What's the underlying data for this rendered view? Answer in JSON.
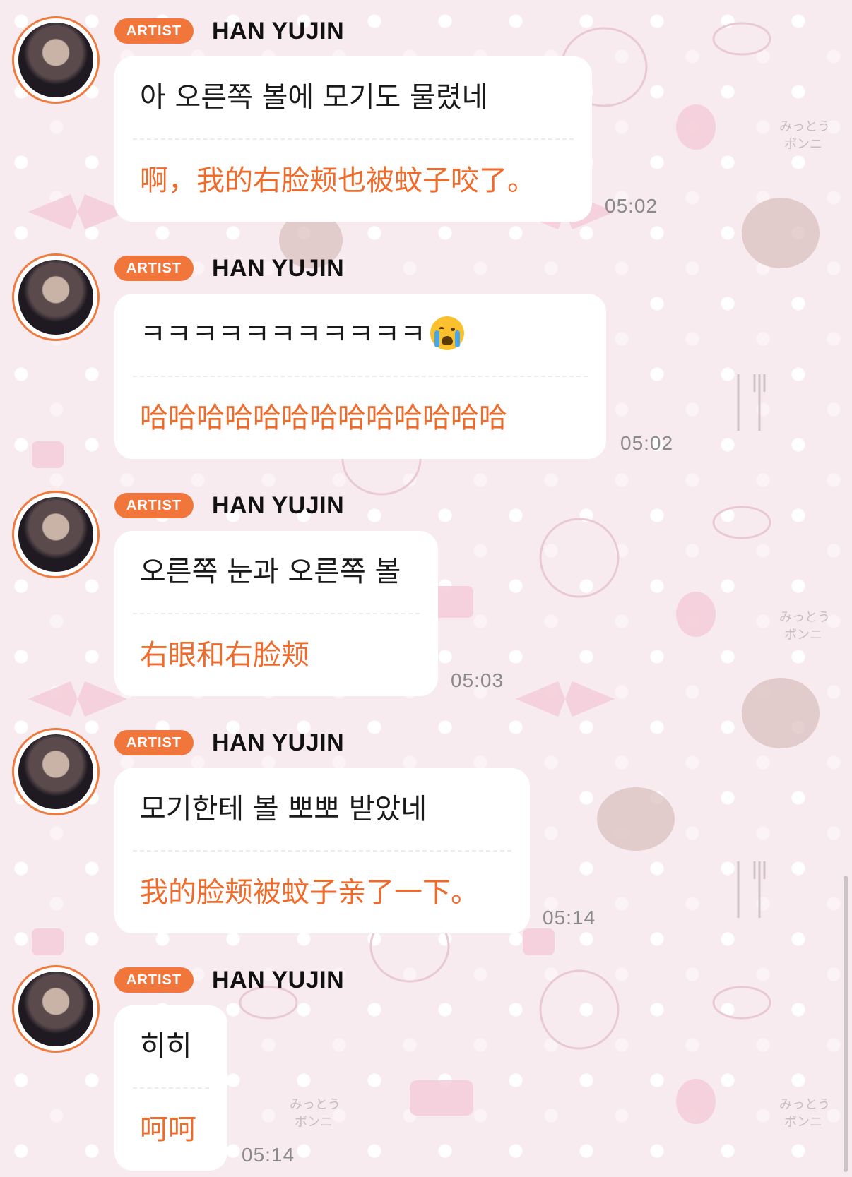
{
  "messages": [
    {
      "badge": "ARTIST",
      "name": "HAN YUJIN",
      "korean": "아 오른쪽 볼에 모기도 물렸네",
      "chinese": "啊，我的右脸颊也被蚊子咬了。",
      "time": "05:02"
    },
    {
      "badge": "ARTIST",
      "name": "HAN YUJIN",
      "korean": "ㅋㅋㅋㅋㅋㅋㅋㅋㅋㅋㅋ",
      "chinese": "哈哈哈哈哈哈哈哈哈哈哈哈哈",
      "time": "05:02",
      "emoji": "loudly-crying-face-icon"
    },
    {
      "badge": "ARTIST",
      "name": "HAN YUJIN",
      "korean": "오른쪽 눈과 오른쪽 볼",
      "chinese": "右眼和右脸颊",
      "time": "05:03"
    },
    {
      "badge": "ARTIST",
      "name": "HAN YUJIN",
      "korean": "모기한테 볼 뽀뽀 받았네",
      "chinese": "我的脸颊被蚊子亲了一下。",
      "time": "05:14"
    },
    {
      "badge": "ARTIST",
      "name": "HAN YUJIN",
      "korean": "히히",
      "chinese": "呵呵",
      "time": "05:14"
    }
  ],
  "colors": {
    "accent": "#f1763c",
    "translation_text": "#ee6b2c",
    "background": "#f7ebef",
    "bubble": "#ffffff"
  }
}
